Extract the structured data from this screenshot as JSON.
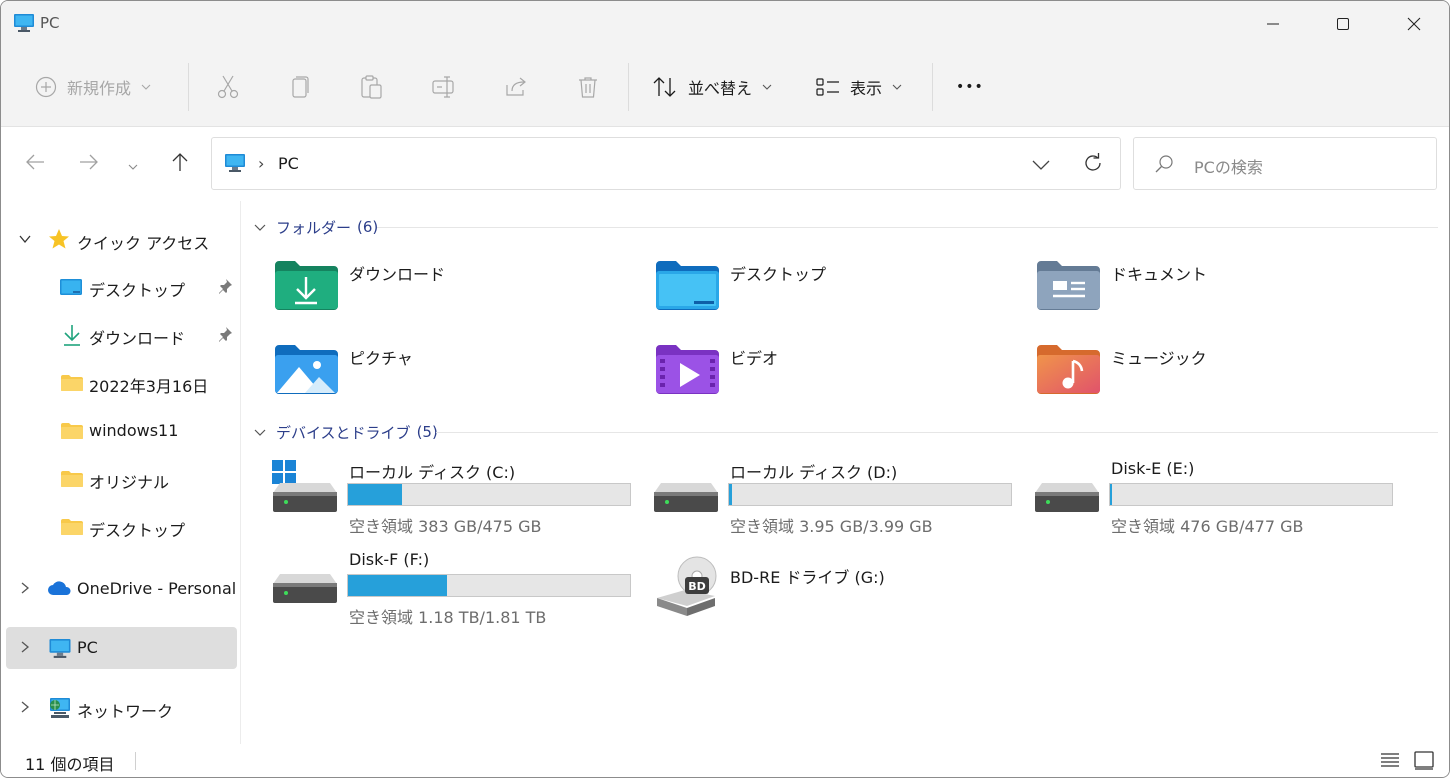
{
  "window": {
    "title": "PC"
  },
  "toolbar": {
    "new_label": "新規作成",
    "sort_label": "並べ替え",
    "view_label": "表示",
    "more_label": "•••"
  },
  "address": {
    "crumb_sep": "›",
    "crumb": "PC"
  },
  "search": {
    "placeholder": "PCの検索"
  },
  "sidebar": {
    "quick_access": "クイック アクセス",
    "items": [
      {
        "label": "デスクトップ",
        "icon": "desktop-folder-icon",
        "pinned": true
      },
      {
        "label": "ダウンロード",
        "icon": "download-arrow-icon",
        "pinned": true
      },
      {
        "label": "2022年3月16日",
        "icon": "folder-icon",
        "pinned": false
      },
      {
        "label": "windows11",
        "icon": "folder-icon",
        "pinned": false
      },
      {
        "label": "オリジナル",
        "icon": "folder-icon",
        "pinned": false
      },
      {
        "label": "デスクトップ",
        "icon": "folder-icon",
        "pinned": false
      }
    ],
    "onedrive": "OneDrive - Personal",
    "pc": "PC",
    "network": "ネットワーク"
  },
  "content": {
    "folders_header": "フォルダー",
    "folders_count": "(6)",
    "folders": [
      {
        "name": "ダウンロード",
        "icon": "downloads-folder-icon"
      },
      {
        "name": "デスクトップ",
        "icon": "desktop-folder-icon"
      },
      {
        "name": "ドキュメント",
        "icon": "documents-folder-icon"
      },
      {
        "name": "ピクチャ",
        "icon": "pictures-folder-icon"
      },
      {
        "name": "ビデオ",
        "icon": "videos-folder-icon"
      },
      {
        "name": "ミュージック",
        "icon": "music-folder-icon"
      }
    ],
    "drives_header": "デバイスとドライブ",
    "drives_count": "(5)",
    "drives": [
      {
        "name": "ローカル ディスク (C:)",
        "free": "空き領域 383 GB/475 GB",
        "used_fraction": 0.19
      },
      {
        "name": "ローカル ディスク (D:)",
        "free": "空き領域 3.95 GB/3.99 GB",
        "used_fraction": 0.01
      },
      {
        "name": "Disk-E (E:)",
        "free": "空き領域 476 GB/477 GB",
        "used_fraction": 0.002
      },
      {
        "name": "Disk-F (F:)",
        "free": "空き領域 1.18 TB/1.81 TB",
        "used_fraction": 0.35
      },
      {
        "name": "BD-RE ドライブ (G:)",
        "badge": "BD"
      }
    ]
  },
  "status": {
    "count": "11 個の項目"
  },
  "colors": {
    "accent": "#26a0da",
    "group_header": "#2c3e8a",
    "selection": "#dedede"
  }
}
